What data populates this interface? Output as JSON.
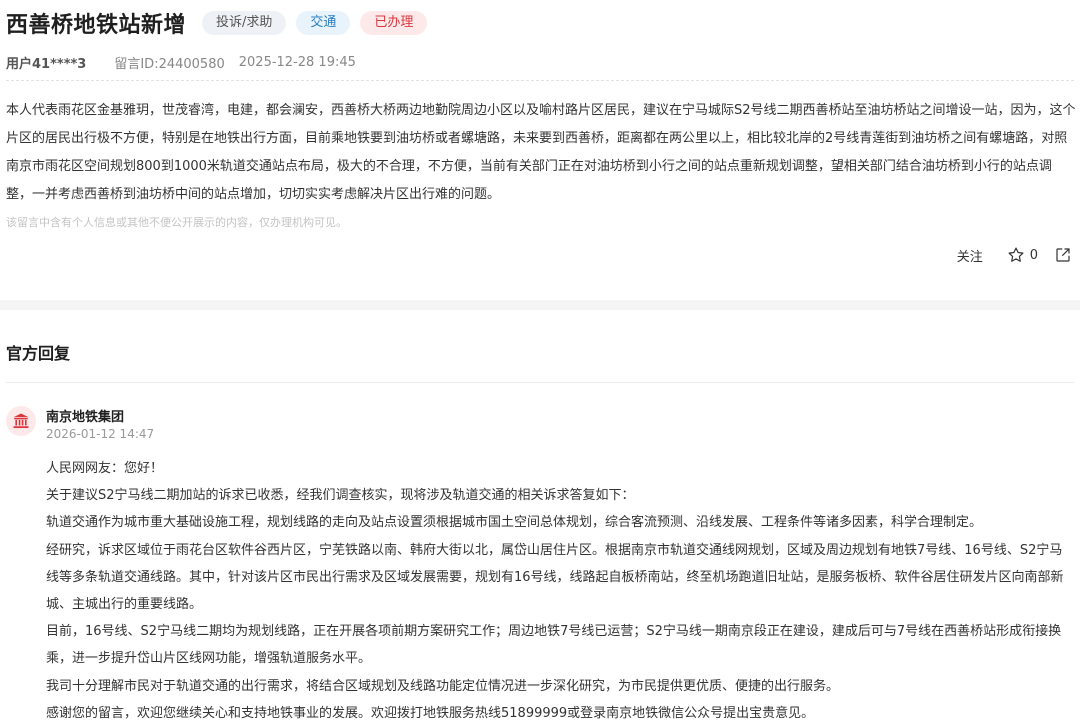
{
  "post": {
    "title": "西善桥地铁站新增",
    "tags": {
      "type": "投诉/求助",
      "category": "交通",
      "status": "已办理"
    },
    "user": "用户41****3",
    "message_id": "留言ID:24400580",
    "timestamp": "2025-12-28 19:45",
    "body": "本人代表雨花区金基雅玥，世茂睿湾，电建，都会澜安，西善桥大桥两边地勤院周边小区以及喻村路片区居民，建议在宁马城际S2号线二期西善桥站至油坊桥站之间增设一站，因为，这个片区的居民出行极不方便，特别是在地铁出行方面，目前乘地铁要到油坊桥或者螺塘路，未来要到西善桥，距离都在两公里以上，相比较北岸的2号线青莲街到油坊桥之间有螺塘路，对照南京市雨花区空间规划800到1000米轨道交通站点布局，极大的不合理，不方便，当前有关部门正在对油坊桥到小行之间的站点重新规划调整，望相关部门结合油坊桥到小行的站点调整，一并考虑西善桥到油坊桥中间的站点增加，切切实实考虑解决片区出行难的问题。",
    "privacy_note": "该留言中含有个人信息或其他不便公开展示的内容，仅办理机构可见。"
  },
  "actions": {
    "follow_label": "关注",
    "star_count": "0",
    "star_icon": "star-outline",
    "share_icon": "share-export"
  },
  "reply": {
    "section_title": "官方回复",
    "org_name": "南京地铁集团",
    "org_icon": "government-building",
    "time": "2026-01-12 14:47",
    "paragraphs": [
      "人民网网友：您好！",
      "关于建议S2宁马线二期加站的诉求已收悉，经我们调查核实，现将涉及轨道交通的相关诉求答复如下：",
      "轨道交通作为城市重大基础设施工程，规划线路的走向及站点设置须根据城市国土空间总体规划，综合客流预测、沿线发展、工程条件等诸多因素，科学合理制定。",
      "经研究，诉求区域位于雨花台区软件谷西片区，宁芜铁路以南、韩府大街以北，属岱山居住片区。根据南京市轨道交通线网规划，区域及周边规划有地铁7号线、16号线、S2宁马线等多条轨道交通线路。其中，针对该片区市民出行需求及区域发展需要，规划有16号线，线路起自板桥南站，终至机场跑道旧址站，是服务板桥、软件谷居住研发片区向南部新城、主城出行的重要线路。",
      "目前，16号线、S2宁马线二期均为规划线路，正在开展各项前期方案研究工作；周边地铁7号线已运营；S2宁马线一期南京段正在建设，建成后可与7号线在西善桥站形成衔接换乘，进一步提升岱山片区线网功能，增强轨道服务水平。",
      "我司十分理解市民对于轨道交通的出行需求，将结合区域规划及线路功能定位情况进一步深化研究，为市民提供更优质、便捷的出行服务。",
      "感谢您的留言，欢迎您继续关心和支持地铁事业的发展。欢迎拨打地铁服务热线51899999或登录南京地铁微信公众号提出宝贵意见。"
    ]
  },
  "colors": {
    "status_red": "#d9363e",
    "category_blue": "#2a7fc4",
    "band_gray": "#f5f5f5"
  }
}
